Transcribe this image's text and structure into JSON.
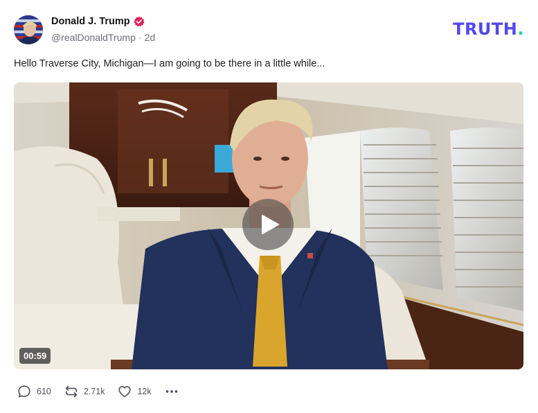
{
  "post": {
    "author_name": "Donald J. Trump",
    "handle": "@realDonaldTrump",
    "separator": "·",
    "timestamp": "2d",
    "text": "Hello Traverse City, Michigan—I am going to be there in a little while...",
    "verified_icon": "verified-badge-icon",
    "colors": {
      "verified": "#e0245e",
      "brand": "#5448ee",
      "brand_accent": "#17d4b0"
    }
  },
  "brand": {
    "name": "TRUTH",
    "suffix": "."
  },
  "video": {
    "duration": "00:59",
    "play_icon": "play-icon"
  },
  "actions": {
    "replies": {
      "icon": "reply-bubble-icon",
      "count": "610"
    },
    "retruths": {
      "icon": "retruth-icon",
      "count": "2.71k"
    },
    "likes": {
      "icon": "heart-icon",
      "count": "12k"
    },
    "more_icon": "more-dots-icon"
  }
}
